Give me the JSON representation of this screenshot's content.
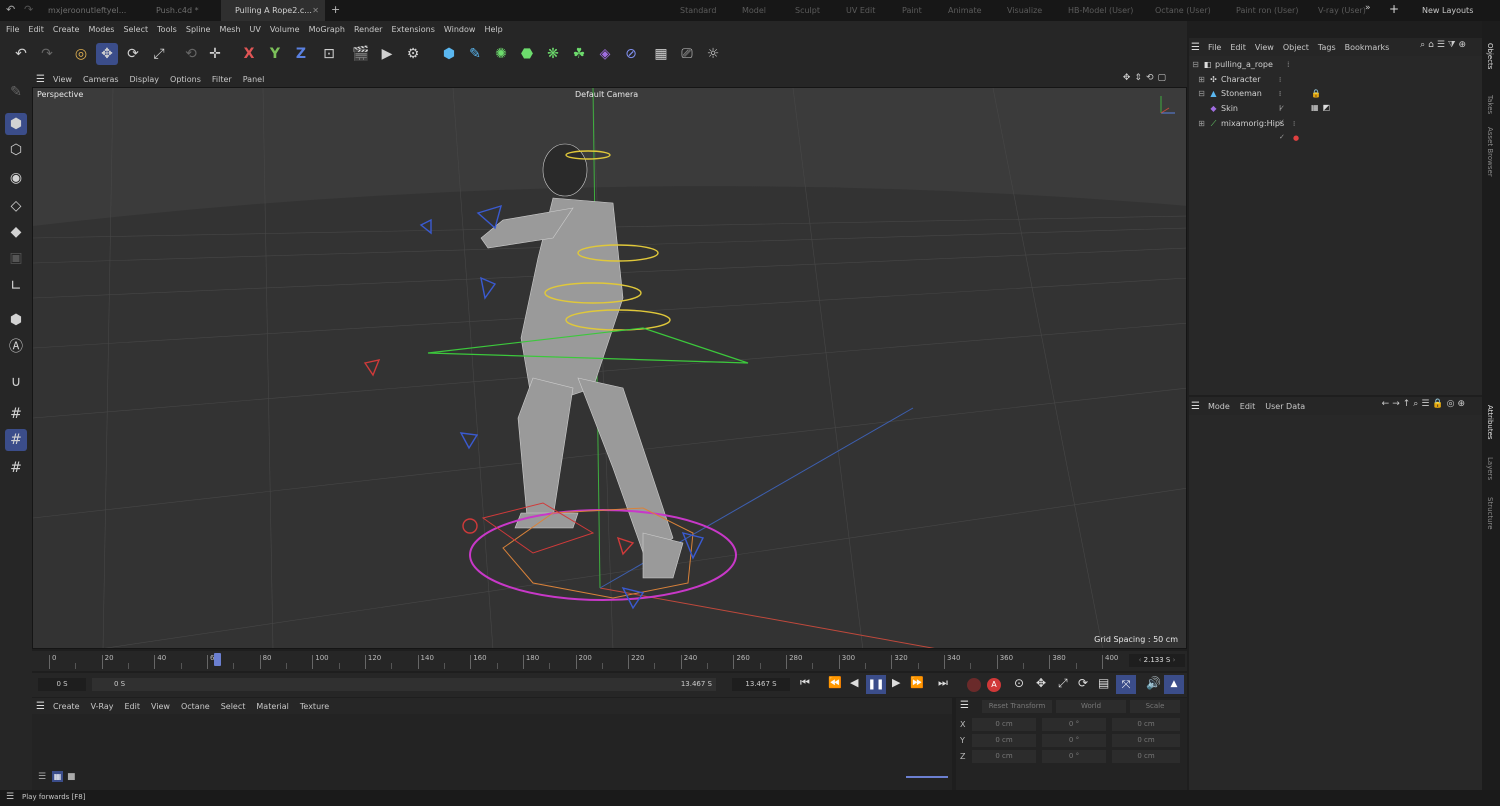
{
  "tabs": [
    {
      "label": "mxjeroonutleftyel..."
    },
    {
      "label": "Push.c4d *"
    },
    {
      "label": "Pulling A Rope2.c..."
    }
  ],
  "layouts": [
    "Standard",
    "Model",
    "Sculpt",
    "UV Edit",
    "Paint",
    "Animate",
    "Visualize",
    "HB-Model (User)",
    "Octane (User)",
    "Paint ron (User)",
    "V-ray (User)"
  ],
  "new_layouts": "New Layouts",
  "menu": [
    "File",
    "Edit",
    "Create",
    "Modes",
    "Select",
    "Tools",
    "Spline",
    "Mesh",
    "UV",
    "Volume",
    "MoGraph",
    "Render",
    "Extensions",
    "Window",
    "Help"
  ],
  "toolbar": {
    "axis_x": "X",
    "axis_y": "Y",
    "axis_z": "Z"
  },
  "viewport": {
    "menu": [
      "View",
      "Cameras",
      "Display",
      "Options",
      "Filter",
      "Panel"
    ],
    "projection": "Perspective",
    "camera": "Default Camera",
    "grid_spacing": "Grid Spacing : 50 cm"
  },
  "timeline": {
    "ticks": [
      "0",
      "20",
      "40",
      "60",
      "80",
      "100",
      "120",
      "140",
      "160",
      "180",
      "200",
      "220",
      "240",
      "260",
      "280",
      "300",
      "320",
      "340",
      "360",
      "380",
      "400"
    ],
    "current_time": "2.133 S",
    "start": "0 S",
    "range_start": "0 S",
    "range_end": "13.467 S",
    "end": "13.467 S",
    "playhead_fraction": 0.16
  },
  "materials_menu": [
    "Create",
    "V-Ray",
    "Edit",
    "View",
    "Octane",
    "Select",
    "Material",
    "Texture"
  ],
  "coordinates": {
    "mode": "Reset Transform",
    "space": "World",
    "scale_mode": "Scale",
    "rows": [
      {
        "axis": "X",
        "pos": "0 cm",
        "rot": "0 °",
        "size": "0 cm"
      },
      {
        "axis": "Y",
        "pos": "0 cm",
        "rot": "0 °",
        "size": "0 cm"
      },
      {
        "axis": "Z",
        "pos": "0 cm",
        "rot": "0 °",
        "size": "0 cm"
      }
    ]
  },
  "object_manager": {
    "menu": [
      "File",
      "Edit",
      "View",
      "Object",
      "Tags",
      "Bookmarks"
    ],
    "objects": [
      {
        "name": "pulling_a_rope",
        "icon": "scene-icon"
      },
      {
        "name": "Character",
        "icon": "character-icon"
      },
      {
        "name": "Stoneman",
        "icon": "figure-icon"
      },
      {
        "name": "Skin",
        "icon": "skin-icon"
      },
      {
        "name": "mixamorig:Hips",
        "icon": "joint-icon"
      }
    ]
  },
  "attributes": {
    "menu": [
      "Mode",
      "Edit",
      "User Data"
    ]
  },
  "side_tabs": [
    "Objects",
    "Takes",
    "Asset Browser",
    "Attributes",
    "Layers",
    "Structure"
  ],
  "status": "Play forwards [F8]",
  "colors": {
    "accent": "#3b4d8a",
    "bg": "#262626",
    "viewport": "#3a3a3a"
  }
}
